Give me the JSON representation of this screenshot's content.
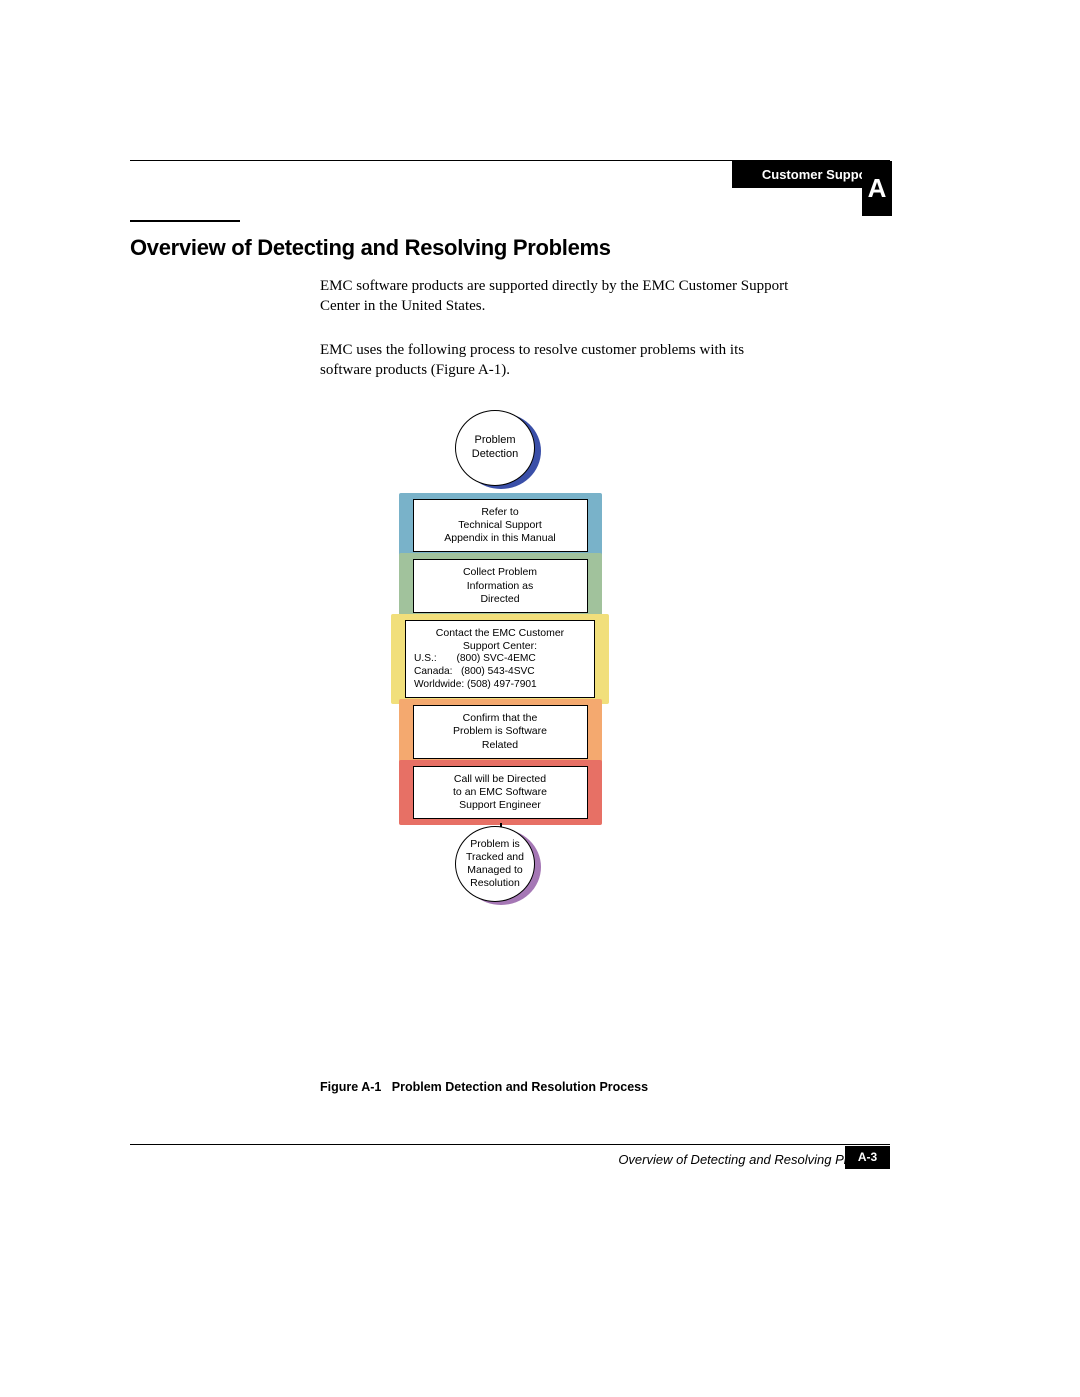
{
  "header": {
    "section": "Customer Support",
    "appendix_letter": "A"
  },
  "title": "Overview of Detecting and Resolving Problems",
  "paragraphs": {
    "p1": "EMC software products are supported directly by the EMC Customer Support Center in the United States.",
    "p2": "EMC uses the following process to resolve customer problems with its software products (Figure A-1)."
  },
  "flow": {
    "start_label": "Problem Detection",
    "steps": [
      {
        "text": "Refer to\nTechnical Support\nAppendix in this Manual",
        "color": "c-blue"
      },
      {
        "text": "Collect Problem\nInformation as\nDirected",
        "color": "c-green"
      },
      {
        "heading": "Contact the EMC Customer\nSupport Center:",
        "phones": [
          {
            "region": "U.S.:",
            "number": "(800) SVC-4EMC"
          },
          {
            "region": "Canada:",
            "number": "(800) 543-4SVC"
          },
          {
            "region": "Worldwide:",
            "number": "(508) 497-7901"
          }
        ],
        "color": "c-yellow"
      },
      {
        "text": "Confirm that the\nProblem is Software\nRelated",
        "color": "c-orange"
      },
      {
        "text": "Call will be Directed\nto an EMC Software\nSupport Engineer",
        "color": "c-red"
      }
    ],
    "end_label": "Problem is\nTracked and\nManaged to\nResolution"
  },
  "figure_caption": {
    "ref": "Figure A-1",
    "title": "Problem Detection and Resolution Process"
  },
  "footer": {
    "title": "Overview of Detecting and Resolving Problems",
    "page": "A-3"
  }
}
